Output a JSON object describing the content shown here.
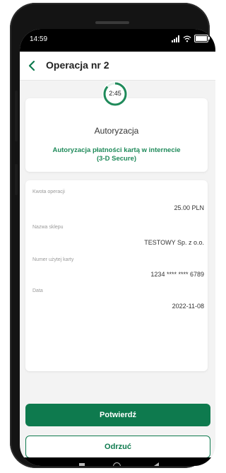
{
  "status_bar": {
    "time": "14:59"
  },
  "header": {
    "title": "Operacja nr 2"
  },
  "timer": {
    "label": "2:45"
  },
  "auth": {
    "title": "Autoryzacja",
    "subtitle_line1": "Autoryzacja płatności kartą w internecie",
    "subtitle_line2": "(3-D Secure)"
  },
  "details": [
    {
      "label": "Kwota operacji",
      "value": "25.00 PLN"
    },
    {
      "label": "Nazwa sklepu",
      "value": "TESTOWY Sp. z o.o."
    },
    {
      "label": "Numer użytej karty",
      "value": "1234 **** **** 6789"
    },
    {
      "label": "Data",
      "value": "2022-11-08"
    }
  ],
  "buttons": {
    "confirm": "Potwierdź",
    "reject": "Odrzuć"
  },
  "colors": {
    "accent": "#0e7a4e",
    "accent_text": "#1f8a5a",
    "background": "#f3f3f3"
  },
  "icons": {
    "back": "chevron-left-icon",
    "signal": "signal-icon",
    "wifi": "wifi-icon",
    "battery": "battery-icon"
  }
}
